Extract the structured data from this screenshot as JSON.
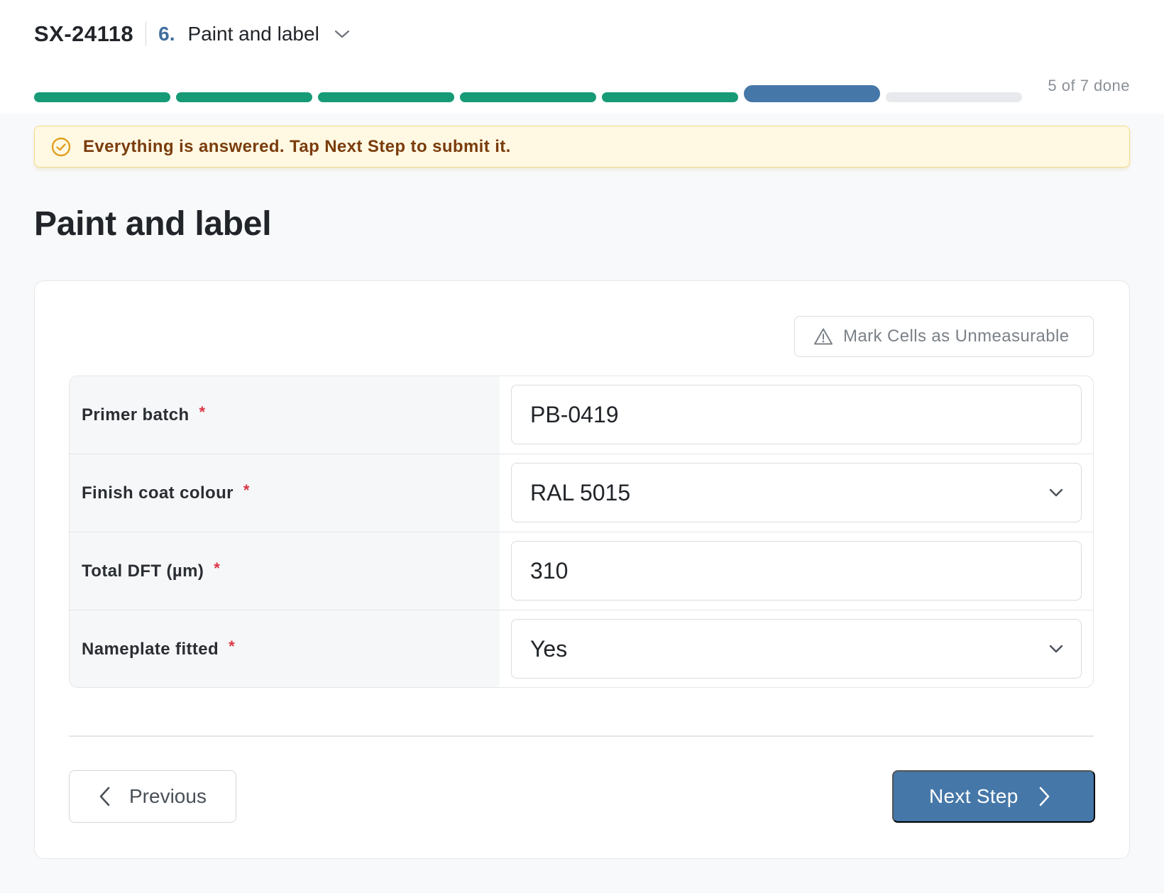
{
  "header": {
    "job_id": "SX-24118",
    "step_number": "6.",
    "step_name": "Paint and label",
    "dropdown_icon": "chevron-down-icon"
  },
  "progress": {
    "label": "5 of 7 done",
    "completed": 5,
    "current": 6,
    "total": 7,
    "colors": {
      "done": "#179b77",
      "current": "#4577a8",
      "todo": "#e7e9ec"
    }
  },
  "alert": {
    "icon": "check-circle-icon",
    "text": "Everything is answered. Tap Next Step to submit it.",
    "colors": {
      "background": "#fff9e3",
      "text": "#7a3c0c"
    }
  },
  "page": {
    "title": "Paint and label"
  },
  "toolbar": {
    "unmeasurable_label": "Mark Cells as Unmeasurable",
    "unmeasurable_icon": "warning-triangle-icon"
  },
  "form": {
    "rows": [
      {
        "label": "Primer batch",
        "required_mark": "*",
        "type": "text",
        "value": "PB-0419"
      },
      {
        "label": "Finish coat colour",
        "required_mark": "*",
        "type": "select",
        "value": "RAL 5015"
      },
      {
        "label": "Total DFT (µm)",
        "required_mark": "*",
        "type": "text",
        "value": "310"
      },
      {
        "label": "Nameplate fitted",
        "required_mark": "*",
        "type": "select",
        "value": "Yes"
      }
    ]
  },
  "navigation": {
    "previous_label": "Previous",
    "next_label": "Next Step",
    "primary_color": "#4577a8"
  }
}
